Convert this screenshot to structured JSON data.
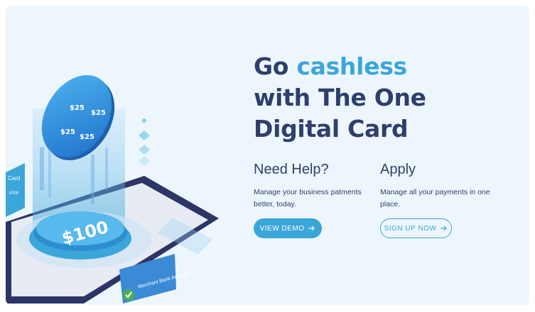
{
  "hero": {
    "headline_part1": "Go ",
    "headline_accent": "cashless",
    "headline_line2": "with The One",
    "headline_line3": "Digital Card"
  },
  "need_help": {
    "title": "Need Help?",
    "description": "Manage your business patments better, today.",
    "button_label": "VIEW DEMO"
  },
  "apply": {
    "title": "Apply",
    "description": "Manage all your payments in one place.",
    "button_label": "SIGN UP NOW"
  },
  "illustration": {
    "coin_label": "$25",
    "base_amount": "$100",
    "side_card_label": "Card",
    "side_card_number": "0000",
    "bank_card_label": "Merchant Bank Account"
  },
  "colors": {
    "accent": "#3aa6da",
    "heading": "#2e3f6c",
    "background": "#eef6fd"
  }
}
